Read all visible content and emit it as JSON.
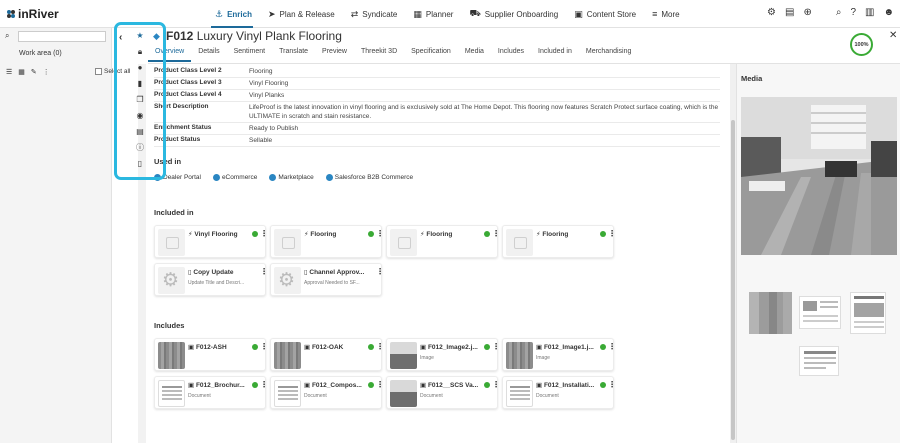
{
  "app": {
    "name": "inRiver"
  },
  "nav": {
    "items": [
      {
        "label": "Enrich",
        "icon": "enrich-icon",
        "active": true
      },
      {
        "label": "Plan & Release",
        "icon": "send-icon"
      },
      {
        "label": "Syndicate",
        "icon": "syndicate-icon"
      },
      {
        "label": "Planner",
        "icon": "calendar-icon"
      },
      {
        "label": "Supplier Onboarding",
        "icon": "truck-icon"
      },
      {
        "label": "Content Store",
        "icon": "store-icon"
      },
      {
        "label": "More",
        "icon": "menu-icon"
      }
    ],
    "accent": "#1d6a9a"
  },
  "leftpanel": {
    "workarea_label": "Work area",
    "workarea_count": "(0)",
    "select_all": "Select all"
  },
  "entity": {
    "code": "F012",
    "name": "Luxury Vinyl Plank Flooring",
    "completeness": "100%"
  },
  "tabs": [
    "Overview",
    "Details",
    "Sentiment",
    "Translate",
    "Preview",
    "Threekit 3D",
    "Specification",
    "Media",
    "Includes",
    "Included in",
    "Merchandising"
  ],
  "fields": [
    {
      "key": "Product Class Level 2",
      "value": "Flooring"
    },
    {
      "key": "Product Class Level 3",
      "value": "Vinyl Flooring"
    },
    {
      "key": "Product Class Level 4",
      "value": "Vinyl Planks"
    },
    {
      "key": "Short Description",
      "value": "LifeProof is the latest innovation in vinyl flooring and is exclusively sold at The Home Depot. This flooring now features Scratch Protect surface coating, which is the ULTIMATE in scratch and stain resistance."
    },
    {
      "key": "Enrichment Status",
      "value": "Ready to Publish"
    },
    {
      "key": "Product Status",
      "value": "Sellable"
    }
  ],
  "used_in": {
    "title": "Used in",
    "channels": [
      "Dealer Portal",
      "eCommerce",
      "Marketplace",
      "Salesforce B2B Commerce"
    ]
  },
  "included_in": {
    "title": "Included in",
    "cards": [
      {
        "name": "Vinyl Flooring",
        "sub": ""
      },
      {
        "name": "Flooring",
        "sub": ""
      },
      {
        "name": "Flooring",
        "sub": ""
      },
      {
        "name": "Flooring",
        "sub": ""
      },
      {
        "name": "Copy Update",
        "sub": "Update Title and Descri..."
      },
      {
        "name": "Channel Approv...",
        "sub": "Approval Needed to SF..."
      }
    ]
  },
  "includes": {
    "title": "Includes",
    "cards": [
      {
        "name": "F012-ASH",
        "sub": ""
      },
      {
        "name": "F012-OAK",
        "sub": ""
      },
      {
        "name": "F012_Image2.j...",
        "sub": "Image"
      },
      {
        "name": "F012_Image1.j...",
        "sub": "Image"
      },
      {
        "name": "F012_Brochur...",
        "sub": "Document"
      },
      {
        "name": "F012_Compos...",
        "sub": "Document"
      },
      {
        "name": "F012__SCS Va...",
        "sub": "Document"
      },
      {
        "name": "F012_Installati...",
        "sub": "Document"
      }
    ]
  },
  "media": {
    "title": "Media"
  }
}
